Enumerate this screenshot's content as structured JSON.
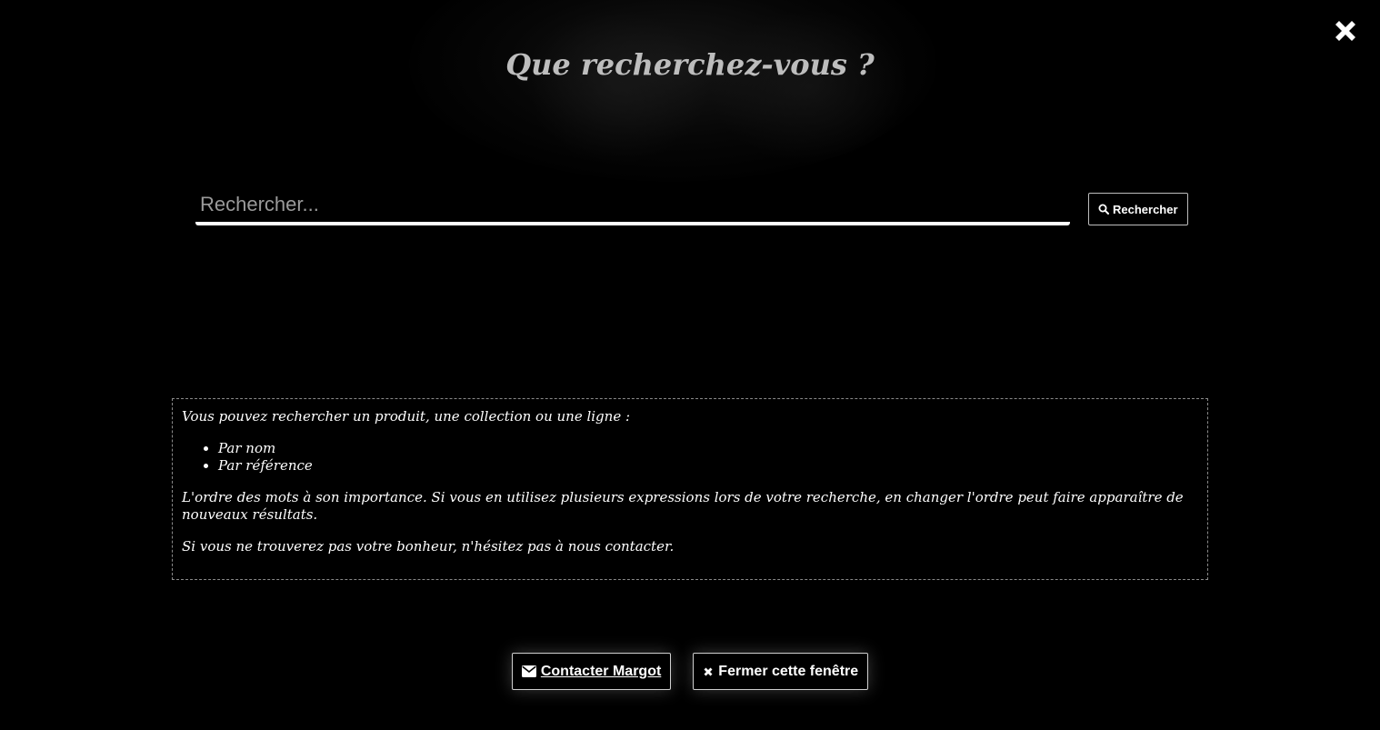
{
  "modal": {
    "title": "Que recherchez-vous ?",
    "close_icon": "close-icon"
  },
  "search": {
    "placeholder": "Rechercher...",
    "value": "",
    "button_label": "Rechercher",
    "button_icon": "search-icon"
  },
  "help": {
    "intro": "Vous pouvez rechercher un produit, une collection ou une ligne :",
    "items": [
      "Par nom",
      "Par référence"
    ],
    "order_note": "L'ordre des mots à son importance. Si vous en utilisez plusieurs expressions lors de votre recherche, en changer l'ordre peut faire apparaître de nouveaux résultats.",
    "contact_note": "Si vous ne trouverez pas votre bonheur, n'hésitez pas à nous contacter."
  },
  "actions": {
    "contact_label": "Contacter Margot",
    "contact_icon": "envelope-icon",
    "close_label": "Fermer cette fenêtre",
    "close_icon": "close-icon"
  },
  "colors": {
    "background": "#000000",
    "title": "#bdbdbd",
    "text": "#ffffff",
    "border": "#8a8a8a"
  }
}
